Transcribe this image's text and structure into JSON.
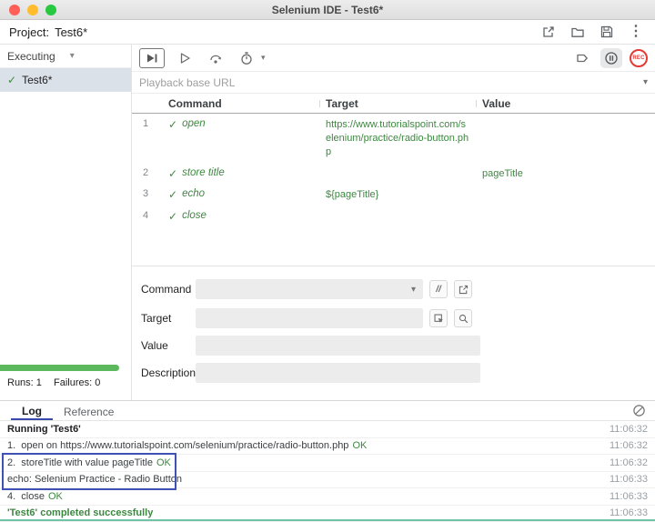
{
  "icons": {
    "check": "✓",
    "chevron_down": "▾",
    "more_vertical": "⋮",
    "comment": "//"
  },
  "titlebar": {
    "title": "Selenium IDE - Test6*"
  },
  "project_bar": {
    "label": "Project:",
    "name": "Test6*"
  },
  "sidebar": {
    "executing_label": "Executing",
    "tests": [
      {
        "name": "Test6*"
      }
    ],
    "runs": "Runs: 1",
    "failures": "Failures: 0"
  },
  "toolbar": {
    "record_label": "REC"
  },
  "playback": {
    "placeholder": "Playback base URL"
  },
  "table": {
    "headers": [
      "Command",
      "Target",
      "Value"
    ],
    "rows": [
      {
        "num": "1",
        "command": "open",
        "target": "https://www.tutorialspoint.com/selenium/practice/radio-button.php",
        "value": ""
      },
      {
        "num": "2",
        "command": "store title",
        "target": "",
        "value": "pageTitle"
      },
      {
        "num": "3",
        "command": "echo",
        "target": "${pageTitle}",
        "value": ""
      },
      {
        "num": "4",
        "command": "close",
        "target": "",
        "value": ""
      }
    ]
  },
  "form": {
    "command_label": "Command",
    "target_label": "Target",
    "value_label": "Value",
    "description_label": "Description"
  },
  "log": {
    "tabs": [
      "Log",
      "Reference"
    ],
    "entries": [
      {
        "text": "Running 'Test6'",
        "ok": "",
        "time": "11:06:32"
      },
      {
        "text": "1.  open on https://www.tutorialspoint.com/selenium/practice/radio-button.php",
        "ok": "OK",
        "time": "11:06:32"
      },
      {
        "text": "2.  storeTitle with value pageTitle",
        "ok": "OK",
        "time": "11:06:32"
      },
      {
        "text": "echo: Selenium Practice - Radio Button",
        "ok": "",
        "time": "11:06:33"
      },
      {
        "text": "4.  close",
        "ok": "OK",
        "time": "11:06:33"
      },
      {
        "text": "'Test6' completed successfully",
        "ok": "",
        "time": "11:06:33"
      }
    ]
  },
  "colors": {
    "accent_green": "#3d8840",
    "annotation_blue": "#3f51b5",
    "record_red": "#e53935",
    "progress_green": "#5cb85c"
  }
}
